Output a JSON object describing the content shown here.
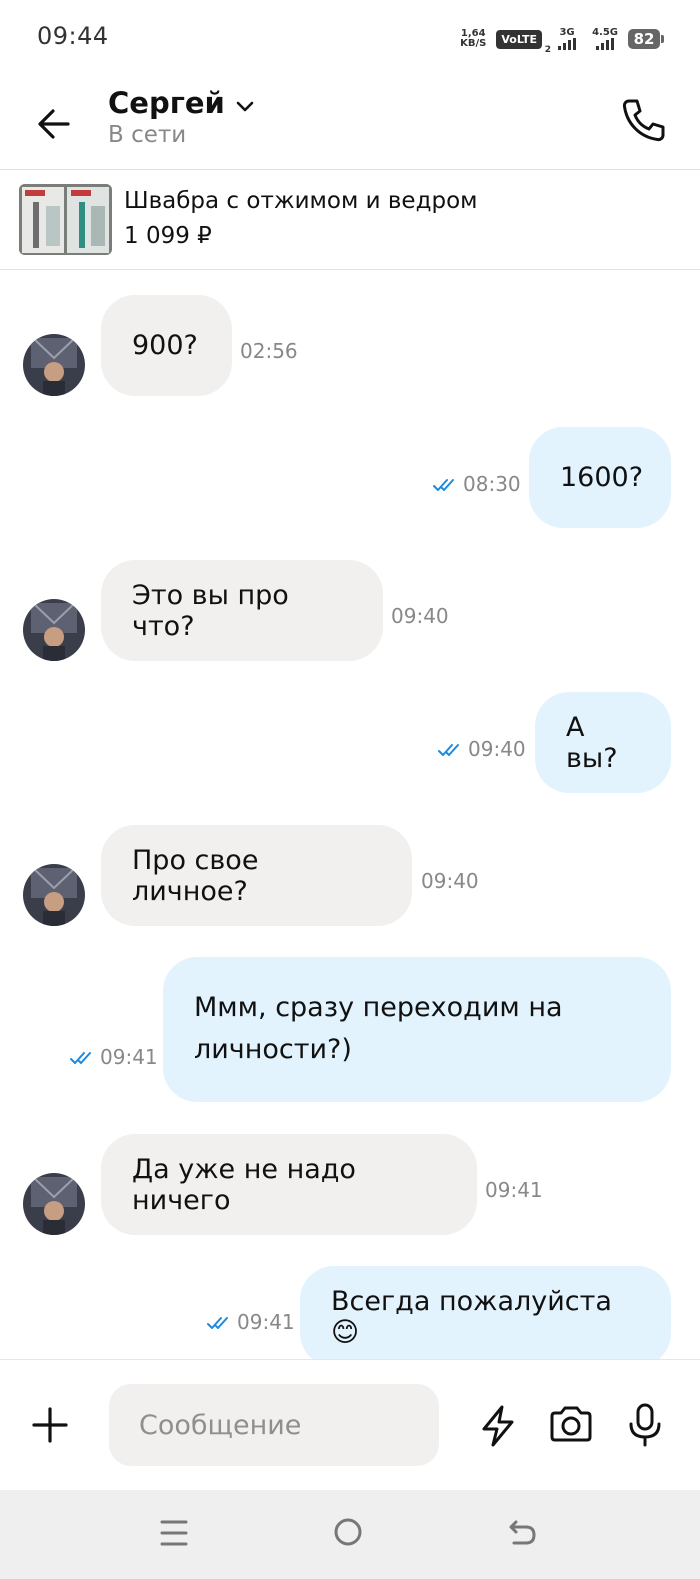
{
  "status_bar": {
    "time": "09:44",
    "net_speed_value": "1,64",
    "net_speed_unit": "KB/S",
    "volte": "VoLTE",
    "volte_sim": "2",
    "sig1_label": "3G",
    "sig2_label": "4.5G",
    "battery": "82"
  },
  "header": {
    "name": "Сергей",
    "status": "В сети"
  },
  "product": {
    "title": "Швабра с отжимом и ведром",
    "price": "1 099 ₽"
  },
  "messages": [
    {
      "dir": "in",
      "text": "900?",
      "time": "02:56"
    },
    {
      "dir": "out",
      "text": "1600?",
      "time": "08:30"
    },
    {
      "dir": "in",
      "text": "Это вы про что?",
      "time": "09:40"
    },
    {
      "dir": "out",
      "text": "А вы?",
      "time": "09:40"
    },
    {
      "dir": "in",
      "text": "Про свое личное?",
      "time": "09:40"
    },
    {
      "dir": "out",
      "text": "Ммм, сразу переходим на личности?)",
      "time": "09:41"
    },
    {
      "dir": "in",
      "text": "Да уже не надо ничего",
      "time": "09:41"
    },
    {
      "dir": "out",
      "text": "Всегда пожалуйста 😊",
      "time": "09:41"
    }
  ],
  "composer": {
    "placeholder": "Сообщение"
  },
  "colors": {
    "incoming_bubble": "#f1f0ef",
    "outgoing_bubble": "#e2f3fd",
    "read_ticks": "#1a8be0"
  }
}
